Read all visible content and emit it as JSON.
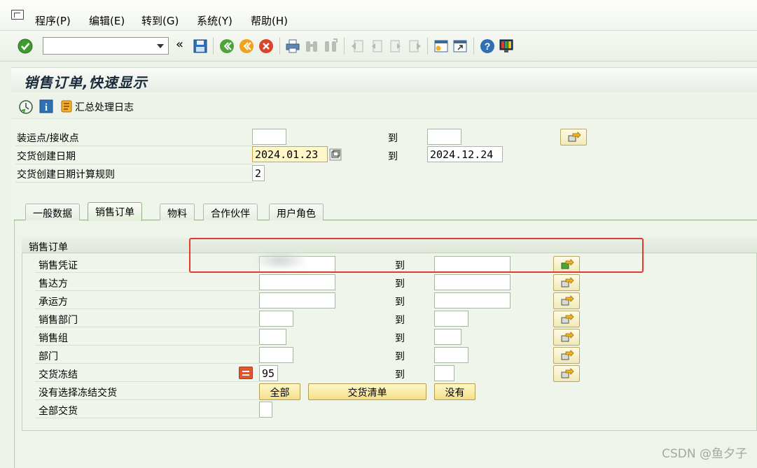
{
  "menu": {
    "items": [
      "程序(P)",
      "编辑(E)",
      "转到(G)",
      "系统(Y)",
      "帮助(H)"
    ]
  },
  "toolbar": {
    "command_field_value": "",
    "collapse_glyph": "«"
  },
  "title": "销售订单,快速显示",
  "app_toolbar": {
    "summary_log_label": "汇总处理日志"
  },
  "header_fields": [
    {
      "label": "装运点/接收点",
      "from": "",
      "to_label": "到",
      "to": ""
    },
    {
      "label": "交货创建日期",
      "from": "2024.01.23",
      "to_label": "到",
      "to": "2024.12.24"
    },
    {
      "label": "交货创建日期计算规则",
      "from": "2"
    }
  ],
  "tabs": [
    "一般数据",
    "销售订单",
    "物料",
    "合作伙伴",
    "用户角色"
  ],
  "active_tab": "销售订单",
  "group": {
    "title": "销售订单",
    "rows": [
      {
        "label": "销售凭证",
        "from": "",
        "to_label": "到",
        "to": ""
      },
      {
        "label": "售达方",
        "from": "",
        "to_label": "到",
        "to": ""
      },
      {
        "label": "承运方",
        "from": "",
        "to_label": "到",
        "to": ""
      },
      {
        "label": "销售部门",
        "from": "",
        "to_label": "到",
        "to": ""
      },
      {
        "label": "销售组",
        "from": "",
        "to_label": "到",
        "to": ""
      },
      {
        "label": "部门",
        "from": "",
        "to_label": "到",
        "to": ""
      },
      {
        "label": "交货冻结",
        "from": "95",
        "to_label": "到",
        "to": ""
      },
      {
        "label": "没有选择冻结交货"
      },
      {
        "label": "全部交货",
        "from": ""
      }
    ],
    "blocked_buttons": [
      "全部",
      "交货清单",
      "没有"
    ]
  },
  "watermark": "CSDN @鱼夕子",
  "colors": {
    "highlight_box": "#e23a2f",
    "required_field": "#fff7c7",
    "button_yellow": "#f3df8a"
  }
}
